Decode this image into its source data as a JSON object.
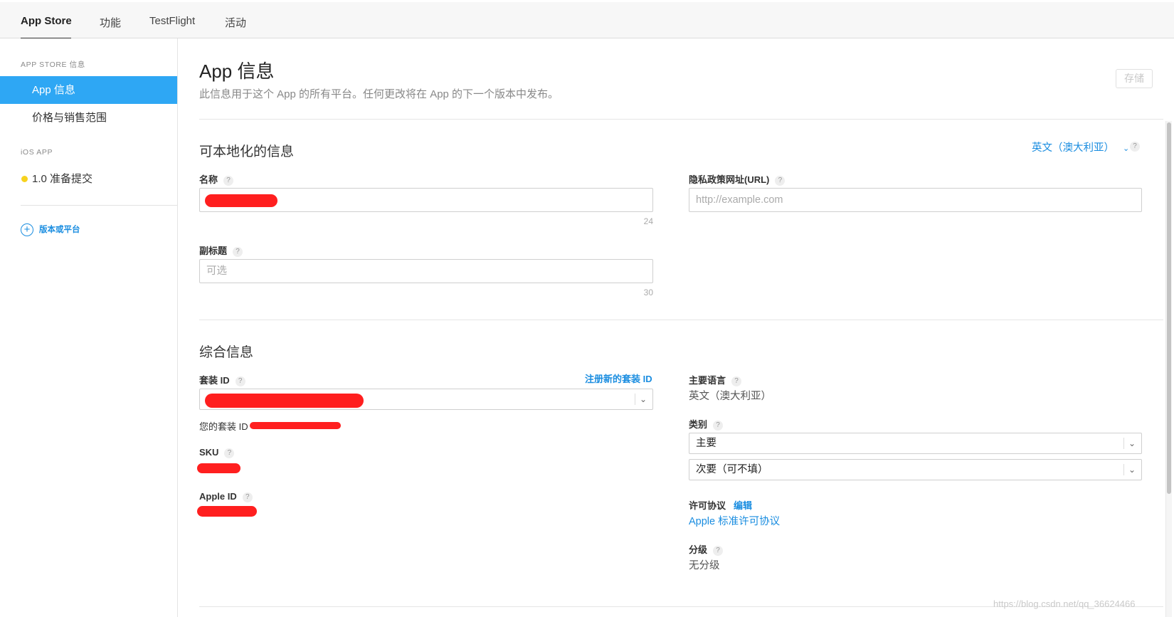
{
  "tabs": [
    {
      "label": "App Store"
    },
    {
      "label": "功能"
    },
    {
      "label": "TestFlight"
    },
    {
      "label": "活动"
    }
  ],
  "sidebar": {
    "section_app_store": "APP STORE 信息",
    "items": [
      {
        "label": "App 信息"
      },
      {
        "label": "价格与销售范围"
      }
    ],
    "section_ios": "iOS APP",
    "version": "1.0 准备提交",
    "add_label": "版本或平台"
  },
  "page": {
    "title": "App 信息",
    "subtitle": "此信息用于这个 App 的所有平台。任何更改将在 App 的下一个版本中发布。",
    "save_label": "存储"
  },
  "localizable": {
    "section_title": "可本地化的信息",
    "language": "英文（澳大利亚）",
    "name_label": "名称",
    "name_count": "24",
    "subtitle_label": "副标题",
    "subtitle_placeholder": "可选",
    "subtitle_count": "30",
    "privacy_label": "隐私政策网址(URL)",
    "privacy_placeholder": "http://example.com"
  },
  "general": {
    "section_title": "综合信息",
    "bundle_label": "套装 ID",
    "register_bundle": "注册新的套装 ID",
    "your_bundle_label": "您的套装 ID",
    "sku_label": "SKU",
    "apple_id_label": "Apple ID",
    "primary_lang_label": "主要语言",
    "primary_lang_value": "英文（澳大利亚）",
    "category_label": "类别",
    "category_primary": "主要",
    "category_secondary": "次要（可不填）",
    "license_label": "许可协议",
    "license_edit": "编辑",
    "license_value": "Apple 标准许可协议",
    "rating_label": "分级",
    "rating_value": "无分级"
  },
  "watermark": "https://blog.csdn.net/qq_36624466",
  "colors": {
    "accent": "#2ea7f4",
    "link": "#1a8de0",
    "redaction": "#ff1f1f",
    "status_dot": "#f7d21e"
  }
}
